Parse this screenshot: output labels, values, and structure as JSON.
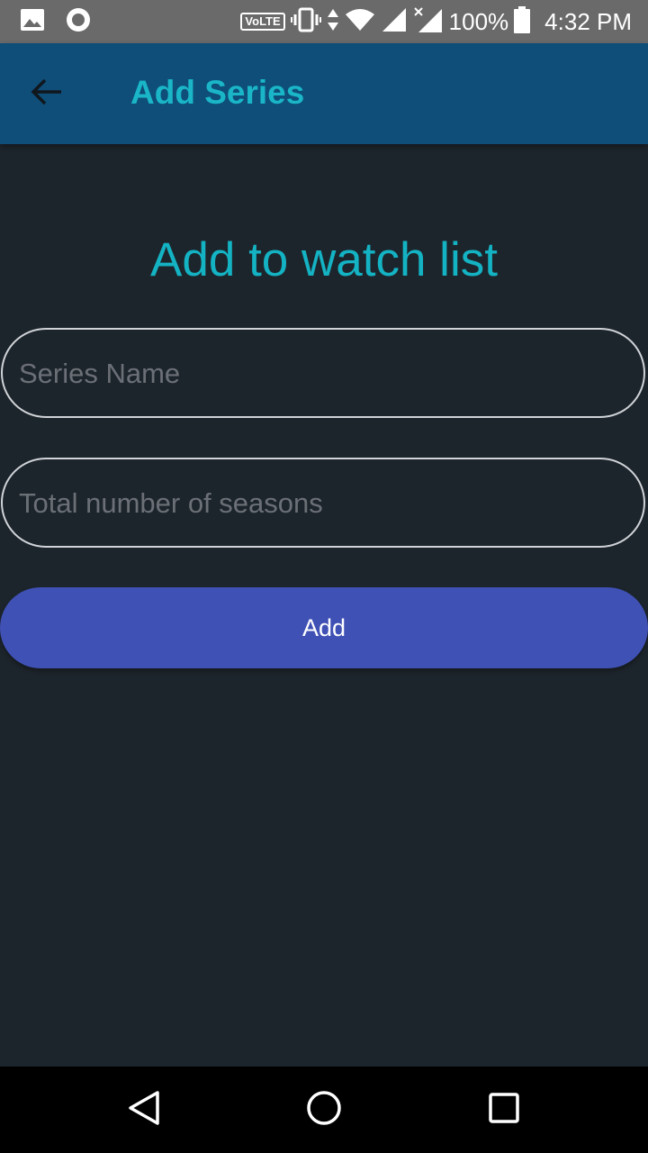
{
  "status_bar": {
    "network_label": "VoLTE",
    "battery": "100%",
    "time": "4:32 PM",
    "icons": [
      "image-icon",
      "record-icon",
      "vibrate-icon",
      "data-arrows-icon",
      "wifi-icon",
      "signal-icon",
      "signal-no-sim-icon",
      "battery-icon"
    ]
  },
  "app_bar": {
    "title": "Add Series",
    "back_icon": "arrow-left-icon",
    "background": "#0e4e79",
    "title_color": "#1ab6c8"
  },
  "form": {
    "heading": "Add to watch list",
    "series_name": {
      "value": "",
      "placeholder": "Series Name"
    },
    "seasons": {
      "value": "",
      "placeholder": "Total number of seasons"
    },
    "submit_label": "Add",
    "button_color": "#3f51b5"
  },
  "nav_bar": {
    "icons": [
      "back-triangle-icon",
      "home-circle-icon",
      "recents-square-icon"
    ]
  }
}
